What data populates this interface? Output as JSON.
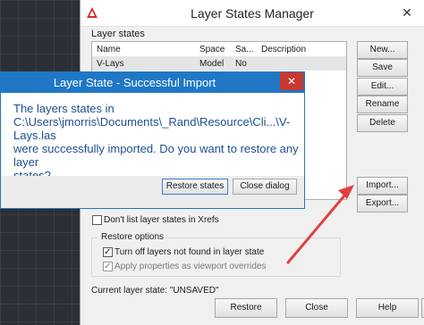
{
  "main_dialog": {
    "title": "Layer States Manager",
    "close_glyph": "✕",
    "logo_icon": "autocad-logo-icon",
    "group_label": "Layer states",
    "columns": [
      "Name",
      "Space",
      "Sa...",
      "Description"
    ],
    "rows": [
      {
        "name": "V-Lays",
        "space": "Model",
        "saved": "No",
        "description": ""
      }
    ],
    "side_buttons": [
      "New...",
      "Save",
      "Edit...",
      "Rename",
      "Delete"
    ],
    "import_button": "Import...",
    "export_button": "Export...",
    "xrefs_checkbox": {
      "label": "Don't list layer states in Xrefs",
      "checked": false
    },
    "restore_options_title": "Restore options",
    "turn_off_checkbox": {
      "label": "Turn off layers not found in layer state",
      "checked": true
    },
    "apply_props_checkbox": {
      "label": "Apply properties as viewport overrides",
      "checked": true,
      "disabled": true
    },
    "check_glyph": "✓",
    "current_state": "Current layer state: \"UNSAVED\"",
    "bottom_buttons": [
      "Restore",
      "Close",
      "Help"
    ],
    "more_glyph": "⟨"
  },
  "popup": {
    "title": "Layer State - Successful Import",
    "close_glyph": "✕",
    "message_lines": [
      "The layers states in",
      "C:\\Users\\jmorris\\Documents\\_Rand\\Resource\\Cli...\\V-Lays.las",
      "were successfully imported.  Do you want to restore any layer",
      "states?"
    ],
    "restore_button": "Restore states",
    "close_button": "Close dialog"
  },
  "colors": {
    "popup_title_bar": "#1f77c6",
    "popup_close": "#c8392f",
    "message_text": "#1e4f91",
    "annotation_arrow": "#e04040"
  }
}
